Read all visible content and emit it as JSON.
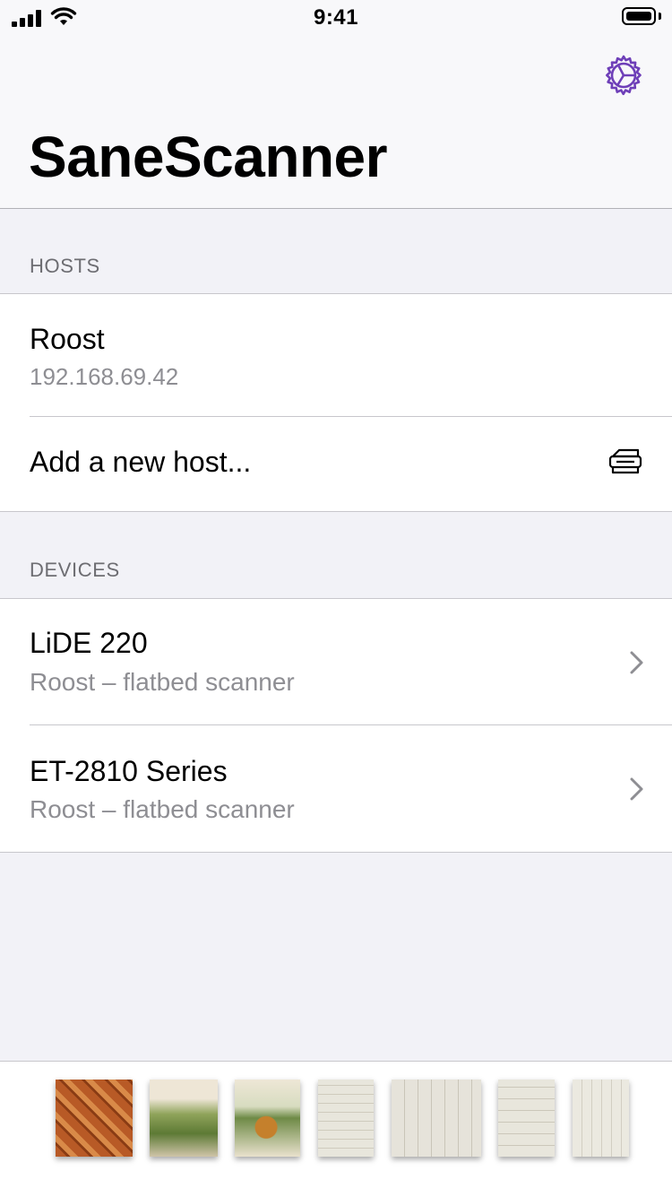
{
  "status_bar": {
    "time": "9:41"
  },
  "nav": {
    "title": "SaneScanner",
    "settings_icon": "gear-icon"
  },
  "hosts_section": {
    "header": "HOSTS",
    "items": [
      {
        "title": "Roost",
        "subtitle": "192.168.69.42"
      }
    ],
    "add_label": "Add a new host...",
    "add_icon": "scanner-icon"
  },
  "devices_section": {
    "header": "DEVICES",
    "items": [
      {
        "title": "LiDE 220",
        "subtitle": "Roost – flatbed scanner"
      },
      {
        "title": "ET-2810 Series",
        "subtitle": "Roost – flatbed scanner"
      }
    ]
  },
  "gallery": {
    "thumbnails": [
      "pineapple-closeup",
      "pineapple-plant",
      "pineapple-illustration",
      "sketch-page",
      "sketch-page",
      "sketch-page",
      "sketch-page"
    ]
  },
  "colors": {
    "accent": "#6e3fb8",
    "background": "#f2f2f7",
    "secondary_text": "#8e8e93",
    "separator": "#c8c7cc"
  }
}
